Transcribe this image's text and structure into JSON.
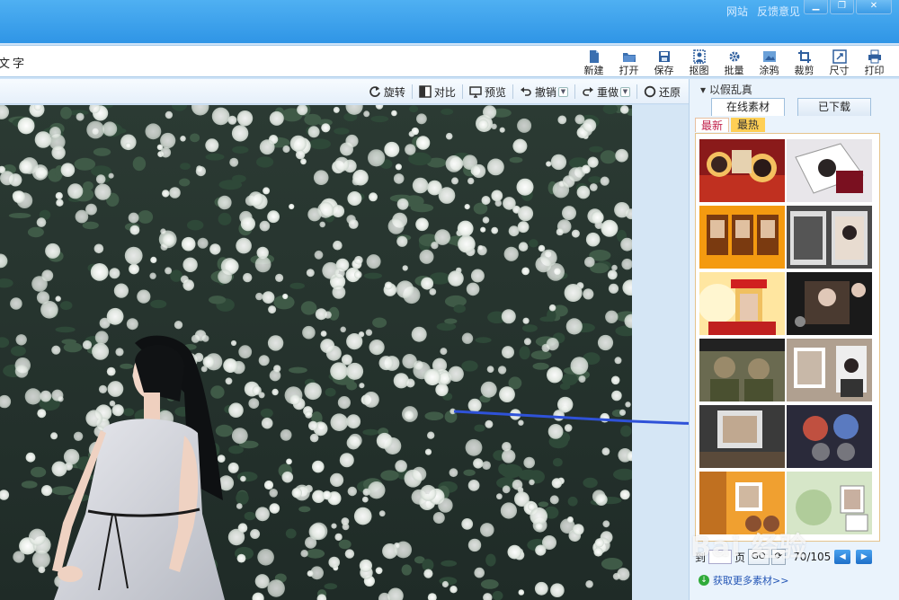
{
  "title_bar": {
    "links": [
      "网站",
      "反馈意见"
    ],
    "buttons": [
      "minimize",
      "maximize",
      "close"
    ]
  },
  "toolbar": {
    "left_text": "文字",
    "tools": [
      {
        "label": "新建",
        "icon": "file-new-icon"
      },
      {
        "label": "打开",
        "icon": "folder-open-icon"
      },
      {
        "label": "保存",
        "icon": "save-icon"
      },
      {
        "label": "抠图",
        "icon": "cutout-icon"
      },
      {
        "label": "批量",
        "icon": "batch-gear-icon"
      },
      {
        "label": "涂鸦",
        "icon": "paint-icon"
      },
      {
        "label": "裁剪",
        "icon": "crop-icon"
      },
      {
        "label": "尺寸",
        "icon": "resize-icon"
      },
      {
        "label": "打印",
        "icon": "printer-icon"
      }
    ]
  },
  "edit_bar": {
    "rotate": "旋转",
    "compare": "对比",
    "preview": "预览",
    "undo": "撤销",
    "redo": "重做",
    "restore": "还原"
  },
  "panel": {
    "title": "以假乱真",
    "tabs": [
      "在线素材",
      "已下载"
    ],
    "subtabs": [
      "最新",
      "最热"
    ],
    "pager": {
      "goto": "到",
      "page_unit": "页",
      "go": "GO",
      "page_info": "70/105"
    },
    "more_link": "获取更多素材>>"
  },
  "watermark": "Bai 经验",
  "colors": {
    "accent": "#2f95e6",
    "arrow": "#2f52d8",
    "hot_tab": "#ffcf55"
  }
}
